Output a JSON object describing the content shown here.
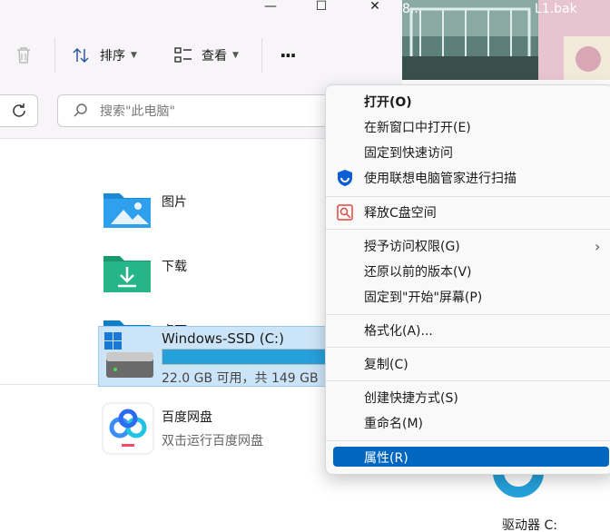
{
  "window": {
    "controls": {
      "minimize": "—",
      "maximize": "☐",
      "close": "✕"
    }
  },
  "toolbar": {
    "delete_icon": "trash-icon",
    "sort_label": "排序",
    "view_label": "查看",
    "more_label": "···"
  },
  "address": {
    "search_placeholder": "搜索\"此电脑\""
  },
  "folders": [
    {
      "label": "图片",
      "icon": "pictures-folder-icon"
    },
    {
      "label": "下载",
      "icon": "downloads-folder-icon"
    },
    {
      "label": "桌面",
      "icon": "desktop-folder-icon"
    }
  ],
  "apps": [
    {
      "label": "百度网盘",
      "sub": "双击运行百度网盘",
      "icon": "baidu-netdisk-icon"
    }
  ],
  "drive": {
    "label": "Windows-SSD (C:)",
    "space": "22.0 GB 可用，共 149 GB",
    "used_fraction": 0.852
  },
  "right_window": {
    "thumb_left": "8...",
    "thumb_right": "L1.bak",
    "drive_caption": "驱动器 C:"
  },
  "context_menu": {
    "items": [
      {
        "label": "打开(O)",
        "bold": true
      },
      {
        "label": "在新窗口中打开(E)"
      },
      {
        "label": "固定到快速访问"
      },
      {
        "label": "使用联想电脑管家进行扫描",
        "icon": "lenovo-shield-icon"
      },
      {
        "label": "释放C盘空间",
        "icon": "cleanup-icon"
      },
      {
        "label": "授予访问权限(G)",
        "submenu": true
      },
      {
        "label": "还原以前的版本(V)"
      },
      {
        "label": "固定到\"开始\"屏幕(P)"
      },
      {
        "label": "格式化(A)..."
      },
      {
        "label": "复制(C)"
      },
      {
        "label": "创建快捷方式(S)"
      },
      {
        "label": "重命名(M)"
      },
      {
        "label": "属性(R)",
        "highlighted": true
      }
    ],
    "submenu_arrow": "›"
  },
  "colors": {
    "accent": "#0067c0",
    "drive_bar": "#26a0da",
    "selection_bg": "#cce4f7"
  }
}
